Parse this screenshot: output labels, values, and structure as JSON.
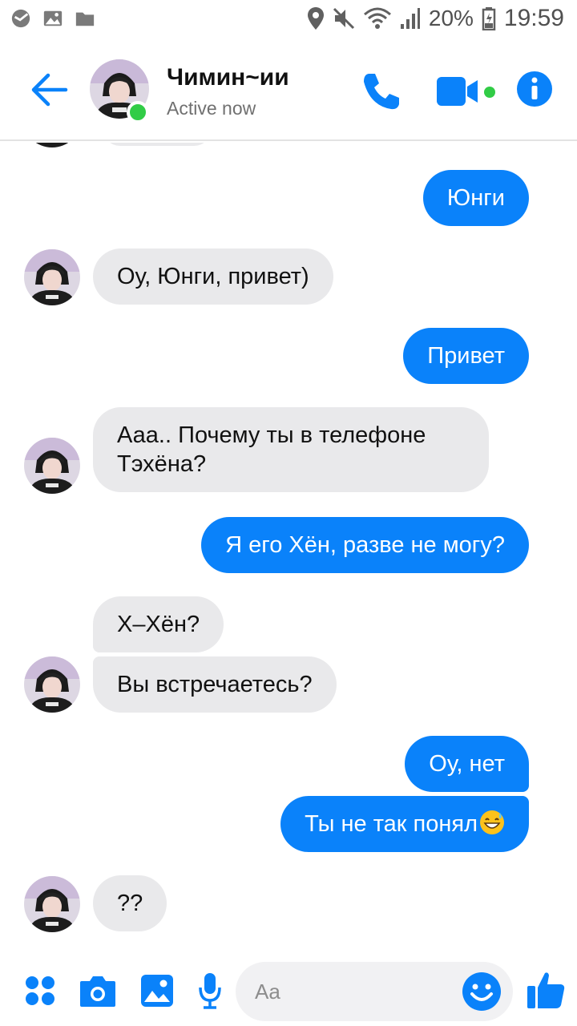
{
  "status_bar": {
    "battery": "20%",
    "time": "19:59",
    "icons": [
      "sberbank-icon",
      "image-icon",
      "folder-icon",
      "location-icon",
      "mute-icon",
      "wifi-icon",
      "signal-icon",
      "battery-icon"
    ]
  },
  "header": {
    "name": "Чимин~ии",
    "status": "Active now",
    "icons": [
      "back-arrow-icon",
      "phone-icon",
      "video-icon",
      "info-icon"
    ],
    "accent": "#0a82fa",
    "online_color": "#31cc46"
  },
  "messages": [
    {
      "from": "me",
      "text": "Юнги"
    },
    {
      "from": "them",
      "text": "Оу, Юнги, привет)"
    },
    {
      "from": "me",
      "text": "Привет"
    },
    {
      "from": "them",
      "line1": "Ааа.. Почему ты в телефоне",
      "line2": "Тэхёна?"
    },
    {
      "from": "me",
      "text": "Я его Хён, разве не могу?"
    },
    {
      "from": "them",
      "text": "Х–Хён?"
    },
    {
      "from": "them",
      "text": "Вы встречаетесь?"
    },
    {
      "from": "me",
      "text": "Оу, нет"
    },
    {
      "from": "me",
      "text": "Ты не так понял",
      "emoji": "grinning-sweat-emoji"
    },
    {
      "from": "them",
      "text": "??"
    }
  ],
  "composer": {
    "placeholder": "Aa",
    "icons": [
      "menu-dots-icon",
      "camera-icon",
      "gallery-icon",
      "microphone-icon",
      "emoji-icon",
      "thumbs-up-icon"
    ]
  }
}
